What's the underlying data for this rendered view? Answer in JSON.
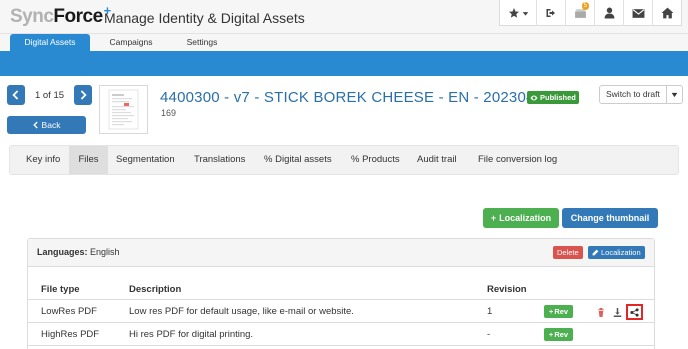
{
  "header": {
    "logo_sync": "Sync",
    "logo_force": "Force",
    "logo_plus": "+",
    "app_title": "Manage Identity & Digital Assets",
    "icons": [
      "star-icon",
      "sign-out-icon",
      "tasks-icon",
      "user-icon",
      "envelope-icon",
      "home-icon"
    ],
    "tasks_badge": "5"
  },
  "nav": {
    "tabs": [
      {
        "label": "Digital Assets",
        "active": true
      },
      {
        "label": "Campaigns",
        "active": false
      },
      {
        "label": "Settings",
        "active": false
      }
    ],
    "accent": "#2a8ad1"
  },
  "asset": {
    "pager_text": "1 of 15",
    "back_label": "Back",
    "title": "4400300 - v7 - STICK BOREK CHEESE - EN - 20230418",
    "status_badge": "Published",
    "id": "169",
    "switch_label": "Switch to draft"
  },
  "subtabs": [
    {
      "label": "Key info",
      "active": false
    },
    {
      "label": "Files",
      "active": true
    },
    {
      "label": "Segmentation",
      "active": false
    },
    {
      "label": "Translations",
      "active": false
    },
    {
      "label": "Digital assets",
      "active": false,
      "icon": "link-icon"
    },
    {
      "label": "Products",
      "active": false,
      "icon": "link-icon"
    },
    {
      "label": "Audit trail",
      "active": false
    },
    {
      "label": "File conversion log",
      "active": false
    }
  ],
  "actions": {
    "localization_label": "Localization",
    "change_thumbnail_label": "Change thumbnail"
  },
  "languages_panel": {
    "languages_label": "Languages:",
    "languages_value": "English",
    "delete_label": "Delete",
    "localization_label": "Localization",
    "columns": [
      "File type",
      "Description",
      "Revision"
    ],
    "rows": [
      {
        "file_type": "LowRes PDF",
        "description": "Low res PDF for default usage, like e-mail or website.",
        "revision": "1",
        "rev_label": "Rev",
        "has_file": true
      },
      {
        "file_type": "HighRes PDF",
        "description": "Hi res PDF for digital printing.",
        "revision": "-",
        "rev_label": "Rev",
        "has_file": false
      }
    ]
  }
}
